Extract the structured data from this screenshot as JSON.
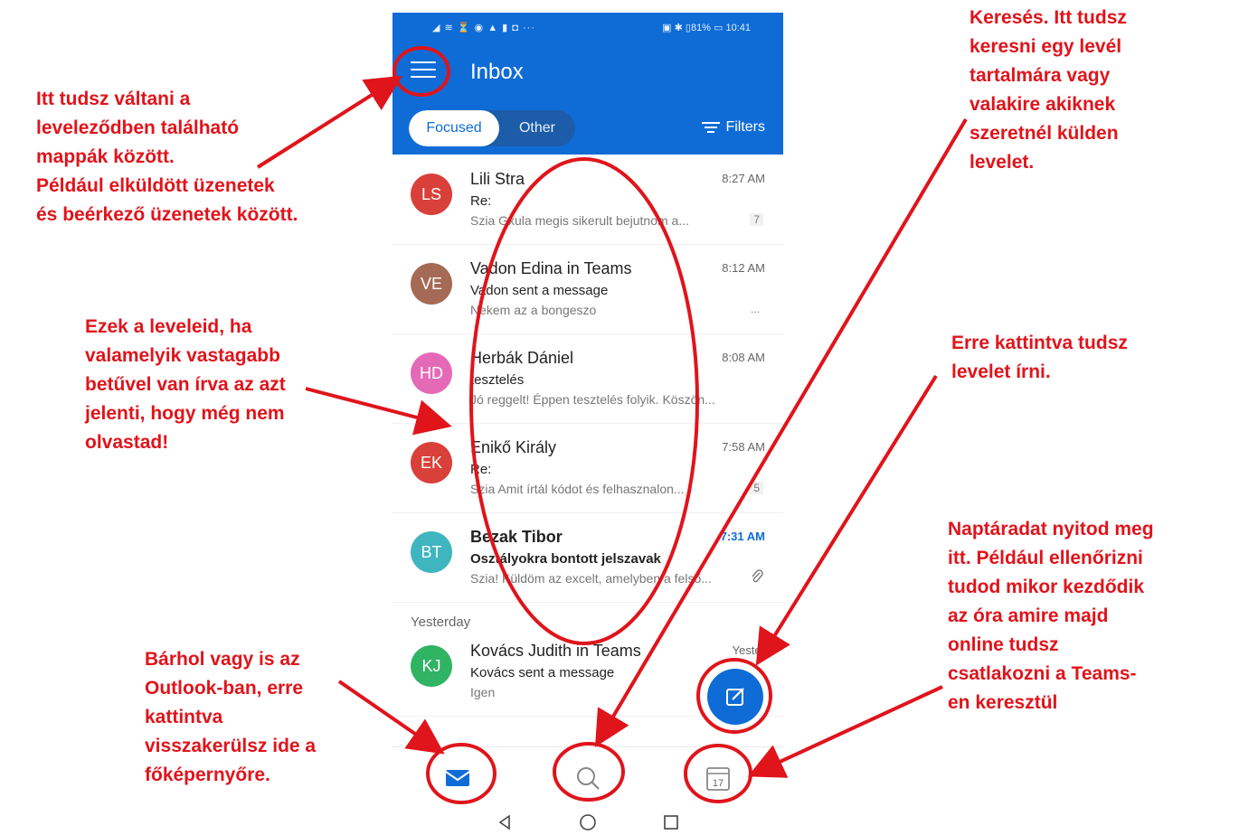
{
  "status": {
    "left": "◢ ≋ ⏳ ◉ ▲ ▮ ◘ ···",
    "right": "▣ ✱ ▯81% ▭ 10:41"
  },
  "header": {
    "title": "Inbox",
    "tabs": [
      "Focused",
      "Other"
    ],
    "filters": "Filters"
  },
  "mails": [
    {
      "initials": "LS",
      "color": "#d9403a",
      "sender": "Lili Stra",
      "time": "8:27 AM",
      "subject": "Re:",
      "preview": "Szia Gxula megis sikerult bejutnom a...",
      "count": "7",
      "unread": false
    },
    {
      "initials": "VE",
      "color": "#a46a55",
      "sender": "Vadon Edina in Teams",
      "time": "8:12 AM",
      "subject": "Vadon sent a message",
      "preview": "Nekem az a bongeszo",
      "count": "...",
      "unread": false
    },
    {
      "initials": "HD",
      "color": "#e46ab8",
      "sender": "Herbák Dániel",
      "time": "8:08 AM",
      "subject": "tesztelés",
      "preview": "Jó reggelt! Éppen tesztelés folyik. Köszön...",
      "count": "",
      "unread": false
    },
    {
      "initials": "EK",
      "color": "#d9403a",
      "sender": "Enikő Király",
      "time": "7:58 AM",
      "subject": "Re:",
      "preview": "Szia Amit írtál kódot és felhasznalon...",
      "count": "5",
      "unread": false
    },
    {
      "initials": "BT",
      "color": "#3fb5c0",
      "sender": "Bezak Tibor",
      "time": "7:31 AM",
      "subject": "Osztályokra bontott jelszavak",
      "preview": "Szia! Küldöm az excelt, amelyben a felső...",
      "count": "",
      "unread": true
    }
  ],
  "section_yesterday": "Yesterday",
  "yesterday_mail": {
    "initials": "KJ",
    "color": "#31b364",
    "sender": "Kovács Judith in Teams",
    "time": "Yester",
    "subject": "Kovács sent a message",
    "preview": "Igen"
  },
  "calendar_day": "17",
  "annotations": {
    "folders": [
      "Itt tudsz váltani a",
      "leveleződben található",
      "mappák között.",
      "Például elküldött üzenetek",
      "és beérkező üzenetek között."
    ],
    "mails": [
      "Ezek a leveleid, ha",
      "valamelyik vastagabb",
      "betűvel van írva az azt",
      "jelenti, hogy még nem",
      "olvastad!"
    ],
    "home": [
      "Bárhol vagy is az",
      "Outlook-ban, erre",
      "kattintva",
      "visszakerülsz ide a",
      "főképernyőre."
    ],
    "search": [
      "Keresés. Itt tudsz",
      "keresni egy levél",
      "tartalmára vagy",
      "valakire akiknek",
      "szeretnél külden",
      "levelet."
    ],
    "compose": [
      "Erre kattintva tudsz",
      "levelet írni."
    ],
    "calendar": [
      "Naptáradat nyitod meg",
      "itt. Például ellenőrizni",
      "tudod mikor kezdődik",
      "az óra amire majd",
      "online tudsz",
      "csatlakozni a Teams-",
      "en keresztül"
    ]
  }
}
